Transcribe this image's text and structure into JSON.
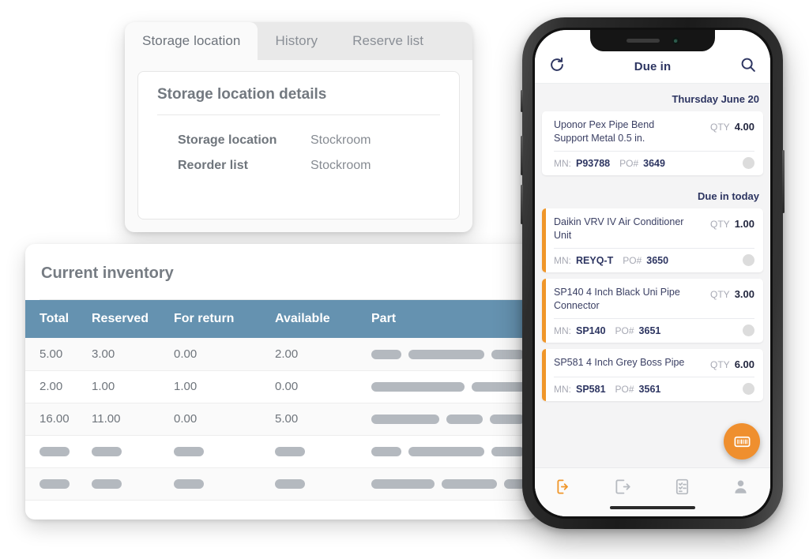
{
  "storage_card": {
    "tabs": [
      {
        "label": "Storage location",
        "active": true
      },
      {
        "label": "History",
        "active": false
      },
      {
        "label": "Reserve list",
        "active": false
      }
    ],
    "panel_title": "Storage location details",
    "details": [
      {
        "label": "Storage location",
        "value": "Stockroom"
      },
      {
        "label": "Reorder list",
        "value": "Stockroom"
      }
    ]
  },
  "inventory_card": {
    "title": "Current inventory",
    "header_color": "#6592b0",
    "columns": [
      "Total",
      "Reserved",
      "For return",
      "Available",
      "Part"
    ],
    "rows": [
      {
        "total": "5.00",
        "reserved": "3.00",
        "for_return": "0.00",
        "available": "2.00",
        "part_bars": [
          38,
          96,
          42
        ]
      },
      {
        "total": "2.00",
        "reserved": "1.00",
        "for_return": "1.00",
        "available": "0.00",
        "part_bars": [
          118,
          70
        ]
      },
      {
        "total": "16.00",
        "reserved": "11.00",
        "for_return": "0.00",
        "available": "5.00",
        "part_bars": [
          86,
          46,
          44
        ]
      },
      {
        "total": "",
        "reserved": "",
        "for_return": "",
        "available": "",
        "part_bars": [
          38,
          96,
          42
        ],
        "skeleton": true
      },
      {
        "total": "",
        "reserved": "",
        "for_return": "",
        "available": "",
        "part_bars": [
          80,
          70,
          30
        ],
        "skeleton": true
      }
    ]
  },
  "phone": {
    "header": {
      "refresh_icon": "refresh-icon",
      "title": "Due in",
      "search_icon": "search-icon"
    },
    "accent_color": "#f09629",
    "sections": [
      {
        "day_label": "Thursday June 20",
        "items": [
          {
            "name": "Uponor Pex Pipe Bend Support Metal 0.5 in.",
            "qty_label": "QTY",
            "qty": "4.00",
            "mn_label": "MN:",
            "mn": "P93788",
            "po_label": "PO#",
            "po": "3649",
            "accent": false
          }
        ]
      },
      {
        "day_label": "Due in today",
        "items": [
          {
            "name": "Daikin VRV IV Air Conditioner Unit",
            "qty_label": "QTY",
            "qty": "1.00",
            "mn_label": "MN:",
            "mn": "REYQ-T",
            "po_label": "PO#",
            "po": "3650",
            "accent": true
          },
          {
            "name": "SP140 4 Inch Black Uni Pipe Connector",
            "qty_label": "QTY",
            "qty": "3.00",
            "mn_label": "MN:",
            "mn": "SP140",
            "po_label": "PO#",
            "po": "3651",
            "accent": true
          },
          {
            "name": "SP581 4 Inch Grey Boss Pipe",
            "qty_label": "QTY",
            "qty": "6.00",
            "mn_label": "MN:",
            "mn": "SP581",
            "po_label": "PO#",
            "po": "3561",
            "accent": true
          }
        ]
      }
    ],
    "fab": {
      "icon": "barcode-icon",
      "color": "#ef8f2e"
    },
    "tabbar": [
      {
        "icon": "due-in-icon",
        "active": true
      },
      {
        "icon": "due-out-icon",
        "active": false
      },
      {
        "icon": "checklist-icon",
        "active": false
      },
      {
        "icon": "person-icon",
        "active": false
      }
    ]
  }
}
